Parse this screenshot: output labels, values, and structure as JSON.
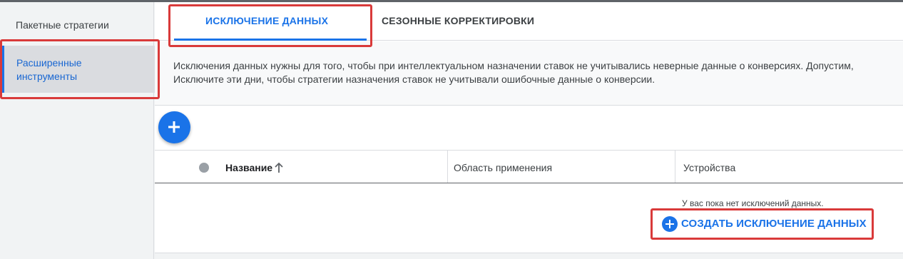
{
  "sidebar": {
    "items": [
      {
        "label": "Пакетные стратегии"
      },
      {
        "label": "Расширенные инструменты"
      }
    ]
  },
  "tabs": [
    {
      "label": "ИСКЛЮЧЕНИЕ ДАННЫХ",
      "active": true
    },
    {
      "label": "СЕЗОННЫЕ КОРРЕКТИРОВКИ",
      "active": false
    }
  ],
  "description": {
    "line1": "Исключения данных нужны для того, чтобы при интеллектуальном назначении ставок не учитывались неверные данные о конверсиях. Допустим,",
    "line2": "Исключите эти дни, чтобы стратегии назначения ставок не учитывали ошибочные данные о конверсии."
  },
  "table": {
    "columns": [
      "Название",
      "Область применения",
      "Устройства"
    ],
    "empty_message": "У вас пока нет исключений данных."
  },
  "actions": {
    "add_icon": "plus-icon",
    "create_label": "СОЗДАТЬ ИСКЛЮЧЕНИЕ ДАННЫХ"
  },
  "colors": {
    "accent": "#1a73e8",
    "highlight": "#d93a3a"
  }
}
